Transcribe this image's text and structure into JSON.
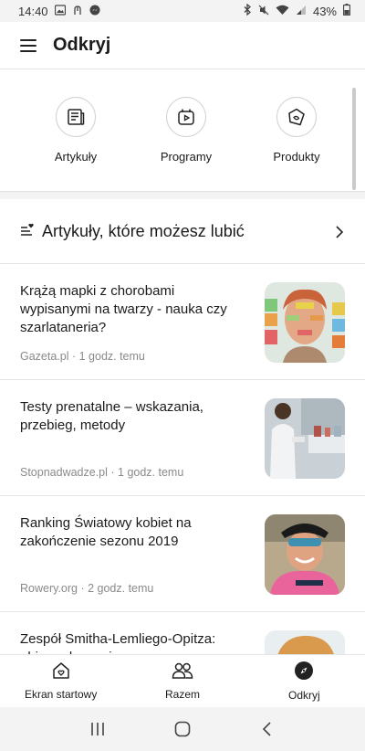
{
  "status_bar": {
    "time": "14:40",
    "battery": "43%"
  },
  "header": {
    "title": "Odkryj"
  },
  "categories": [
    {
      "label": "Artykuły",
      "icon": "article-icon"
    },
    {
      "label": "Programy",
      "icon": "program-icon"
    },
    {
      "label": "Produkty",
      "icon": "product-icon"
    }
  ],
  "feed": {
    "title": "Artykuły, które możesz lubić",
    "articles": [
      {
        "title": "Krążą mapki z chorobami wypisanymi na twarzy - nauka czy szarlataneria?",
        "source": "Gazeta.pl · 1 godz. temu"
      },
      {
        "title": "Testy prenatalne – wskazania, przebieg, metody",
        "source": "Stopnadwadze.pl · 1 godz. temu"
      },
      {
        "title": "Ranking Światowy kobiet na zakończenie sezonu 2019",
        "source": "Rowery.org · 2 godz. temu"
      },
      {
        "title": "Zespół Smitha-Lemliego-Opitza: objawy, leczenie",
        "source": ""
      }
    ]
  },
  "bottom_nav": [
    {
      "label": "Ekran startowy",
      "icon": "home-heart-icon"
    },
    {
      "label": "Razem",
      "icon": "people-icon"
    },
    {
      "label": "Odkryj",
      "icon": "compass-icon",
      "active": true
    }
  ],
  "colors": {
    "background": "#f3f3f3",
    "card": "#ffffff",
    "text": "#1b1b1b",
    "meta": "#8a8a8a"
  }
}
